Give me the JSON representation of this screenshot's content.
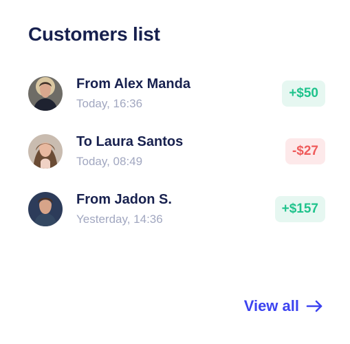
{
  "header": {
    "title": "Customers list"
  },
  "transactions": [
    {
      "title": "From Alex Manda",
      "time": "Today, 16:36",
      "amount": "+$50",
      "tone": "positive"
    },
    {
      "title": "To Laura Santos",
      "time": "Today, 08:49",
      "amount": "-$27",
      "tone": "negative"
    },
    {
      "title": "From Jadon S.",
      "time": "Yesterday, 14:36",
      "amount": "+$157",
      "tone": "positive"
    }
  ],
  "footer": {
    "view_all_label": "View all",
    "view_all_icon": "arrow-right-icon"
  },
  "colors": {
    "title": "#17204e",
    "subtext": "#a1a7c0",
    "positive_text": "#1fc38c",
    "positive_bg": "#e6f7f1",
    "negative_text": "#ef5b5b",
    "negative_bg": "#fde9ea",
    "accent": "#3c43f0"
  }
}
